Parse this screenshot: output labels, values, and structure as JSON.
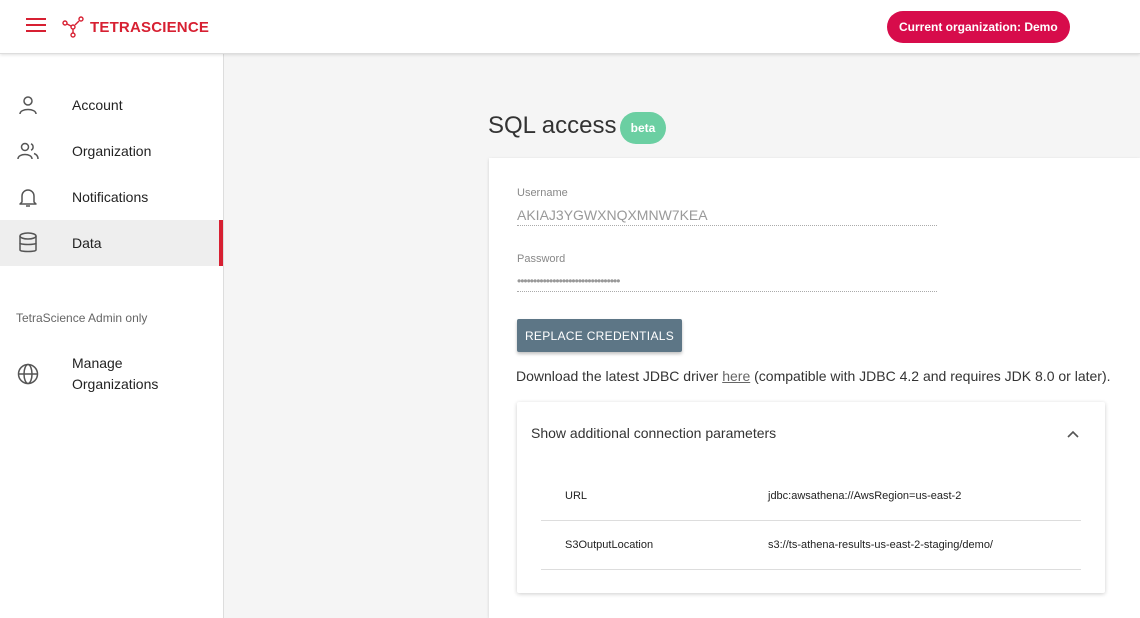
{
  "header": {
    "brand": "TETRASCIENCE",
    "org_button": "Current organization: Demo"
  },
  "sidebar": {
    "items": [
      {
        "label": "Account",
        "icon": "person-icon"
      },
      {
        "label": "Organization",
        "icon": "people-icon"
      },
      {
        "label": "Notifications",
        "icon": "bell-icon"
      },
      {
        "label": "Data",
        "icon": "database-icon",
        "active": true
      }
    ],
    "admin_section_label": "TetraScience Admin only",
    "admin_items": [
      {
        "label_line1": "Manage",
        "label_line2": "Organizations",
        "icon": "globe-icon"
      }
    ]
  },
  "main": {
    "title": "SQL access",
    "badge": "beta",
    "username_label": "Username",
    "username_value": "AKIAJ3YGWXNQXMNW7KEA",
    "password_label": "Password",
    "password_value": "••••••••••••••••••••••••••••••••",
    "replace_button": "REPLACE CREDENTIALS",
    "download_prefix": "Download the latest JDBC driver ",
    "download_link": "here",
    "download_suffix": " (compatible with JDBC 4.2 and requires JDK 8.0 or later).",
    "panel_title": "Show additional connection parameters",
    "params": [
      {
        "key": "URL",
        "value": "jdbc:awsathena://AwsRegion=us-east-2"
      },
      {
        "key": "S3OutputLocation",
        "value": "s3://ts-athena-results-us-east-2-staging/demo/"
      }
    ]
  },
  "colors": {
    "brand_red": "#d72032",
    "org_button": "#d70c4b",
    "beta_badge": "#6bcfa2",
    "replace_button": "#5d7686"
  }
}
